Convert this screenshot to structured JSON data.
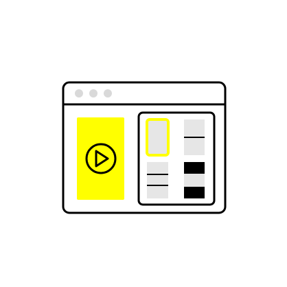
{
  "illustration": {
    "icons": {
      "window": "browser-window-icon",
      "window_dots": "window-control-dots-icon",
      "video_panel": "video-thumbnail-icon",
      "play": "play-icon",
      "gallery": "thumbnail-grid-icon"
    },
    "colors": {
      "stroke": "#000000",
      "background": "#ffffff",
      "accent_yellow": "#ffff00",
      "dot_gray": "#d9d9d9",
      "tile_gray": "#e6e6e6",
      "tile_dark": "#000000"
    }
  }
}
